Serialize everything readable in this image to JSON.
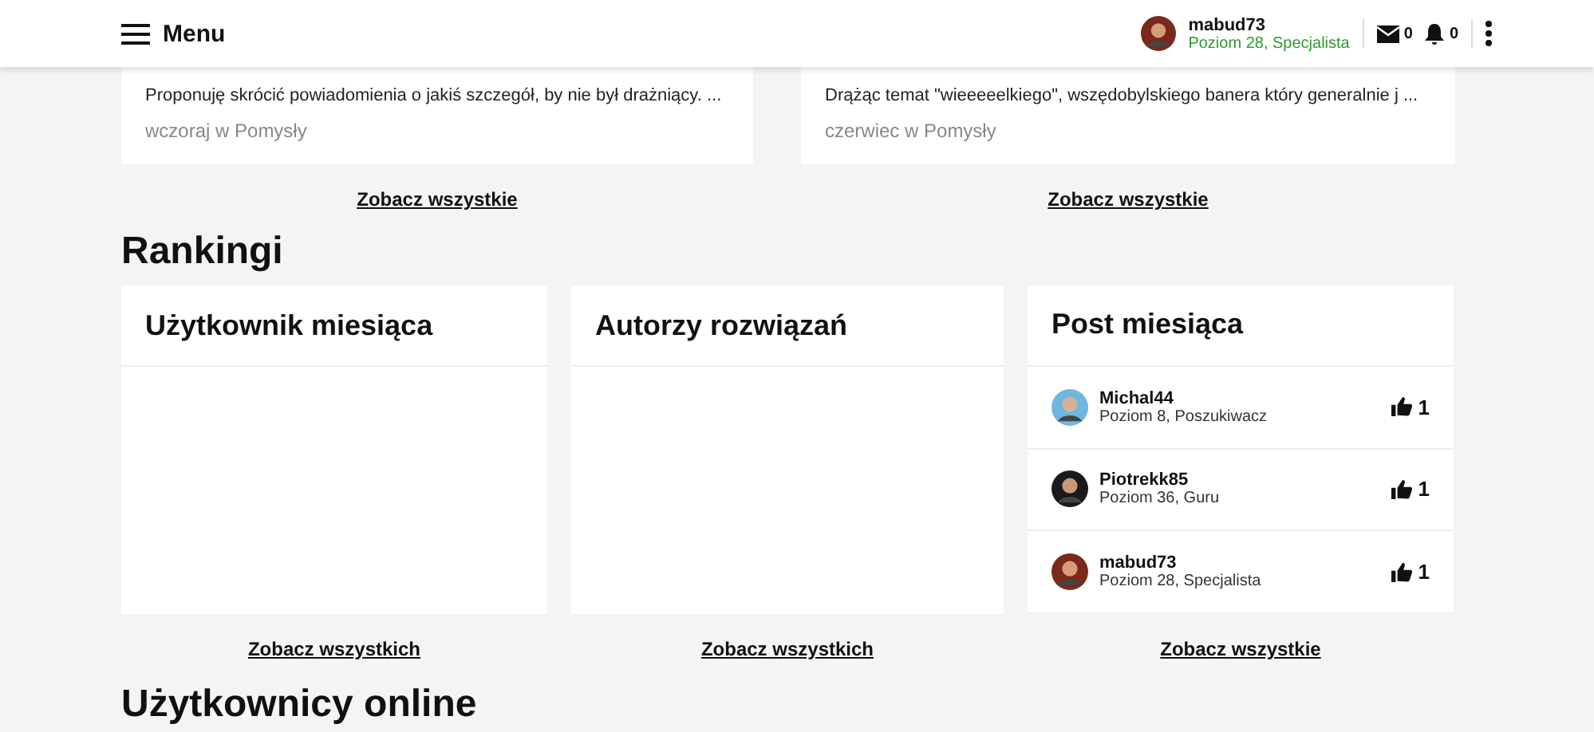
{
  "header": {
    "menu_label": "Menu",
    "user": {
      "name": "mabud73",
      "rank": "Poziom 28, Specjalista"
    },
    "messages_count": "0",
    "notifications_count": "0"
  },
  "ideas": [
    {
      "excerpt": "Proponuję skrócić powiadomienia o jakiś szczegół, by nie był drażniący. ...",
      "meta": "wczoraj w Pomysły",
      "link": "Zobacz wszystkie"
    },
    {
      "excerpt": "Drążąc temat \"wieeeeelkiego\", wszędobylskiego banera który generalnie j ...",
      "meta": "czerwiec w Pomysły",
      "link": "Zobacz wszystkie"
    }
  ],
  "rankings": {
    "title": "Rankingi",
    "panels": [
      {
        "title": "Użytkownik miesiąca",
        "link": "Zobacz wszystkich"
      },
      {
        "title": "Autorzy rozwiązań",
        "link": "Zobacz wszystkich"
      },
      {
        "title": "Post miesiąca",
        "link": "Zobacz wszystkie",
        "rows": [
          {
            "name": "Michal44",
            "rank": "Poziom 8, Poszukiwacz",
            "likes": "1"
          },
          {
            "name": "Piotrekk85",
            "rank": "Poziom 36, Guru",
            "likes": "1"
          },
          {
            "name": "mabud73",
            "rank": "Poziom 28, Specjalista",
            "likes": "1"
          }
        ]
      }
    ]
  },
  "online": {
    "title": "Użytkownicy online"
  }
}
